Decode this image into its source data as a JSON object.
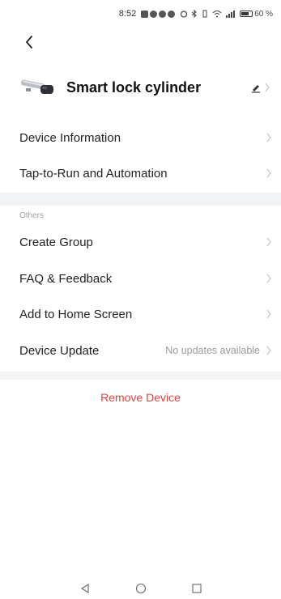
{
  "status_bar": {
    "time": "8:52",
    "battery": "60 %",
    "battery_level": 0.6
  },
  "device": {
    "name": "Smart lock cylinder"
  },
  "rows_main": [
    {
      "label": "Device Information"
    },
    {
      "label": "Tap-to-Run and Automation"
    }
  ],
  "others_section": {
    "header": "Others",
    "rows": [
      {
        "label": "Create Group",
        "value": ""
      },
      {
        "label": "FAQ & Feedback",
        "value": ""
      },
      {
        "label": "Add to Home Screen",
        "value": ""
      },
      {
        "label": "Device Update",
        "value": "No updates available"
      }
    ]
  },
  "remove_label": "Remove Device",
  "colors": {
    "danger": "#d9463e",
    "section_bg": "#f3f4f6",
    "muted": "#999999"
  },
  "icons": {
    "back": "chevron-left-icon",
    "edit": "pencil-icon",
    "row_chevron": "chevron-right-icon",
    "nav_back": "triangle-back-icon",
    "nav_home": "circle-home-icon",
    "nav_recent": "square-recent-icon"
  }
}
